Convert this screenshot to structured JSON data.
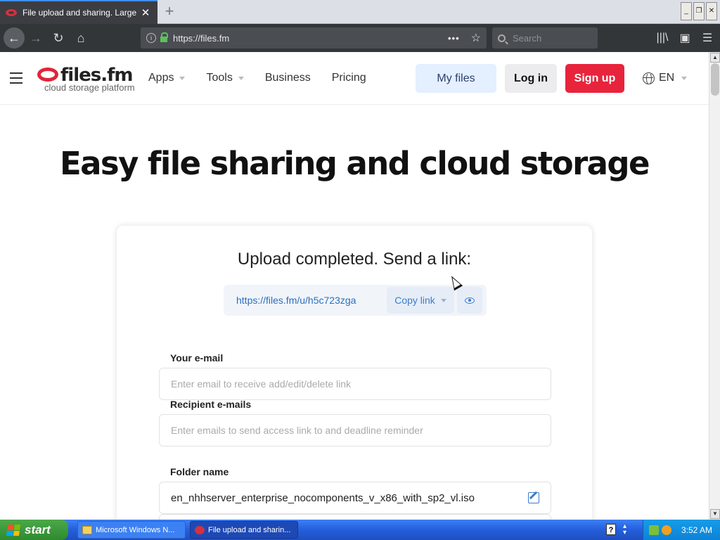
{
  "browser": {
    "tab_title": "File upload and sharing. Large file",
    "url": "https://files.fm",
    "search_placeholder": "Search"
  },
  "site": {
    "logo_word": "files.fm",
    "logo_tagline": "cloud storage platform",
    "nav": [
      {
        "label": "Apps",
        "has_dropdown": true
      },
      {
        "label": "Tools",
        "has_dropdown": true
      },
      {
        "label": "Business",
        "has_dropdown": false
      },
      {
        "label": "Pricing",
        "has_dropdown": false
      }
    ],
    "my_files_label": "My files",
    "login_label": "Log in",
    "signup_label": "Sign up",
    "language": "EN"
  },
  "hero": {
    "title": "Easy file sharing and cloud storage"
  },
  "upload": {
    "title": "Upload completed. Send a link:",
    "link": "https://files.fm/u/h5c723zga",
    "copy_label": "Copy link"
  },
  "form": {
    "email_label": "Your e-mail",
    "email_placeholder": "Enter email to receive add/edit/delete link",
    "recipients_label": "Recipient e-mails",
    "recipients_placeholder": "Enter emails to send access link to and deadline reminder",
    "folder_label": "Folder name",
    "folder_value": "en_nhhserver_enterprise_nocomponents_v_x86_with_sp2_vl.iso"
  },
  "taskbar": {
    "start_label": "start",
    "tasks": [
      "Microsoft Windows N...",
      "File upload and sharin..."
    ],
    "clock": "3:52 AM"
  },
  "colors": {
    "brand_red": "#e8243c",
    "link_blue": "#2a6fc0",
    "my_files_bg": "#e4efff"
  }
}
